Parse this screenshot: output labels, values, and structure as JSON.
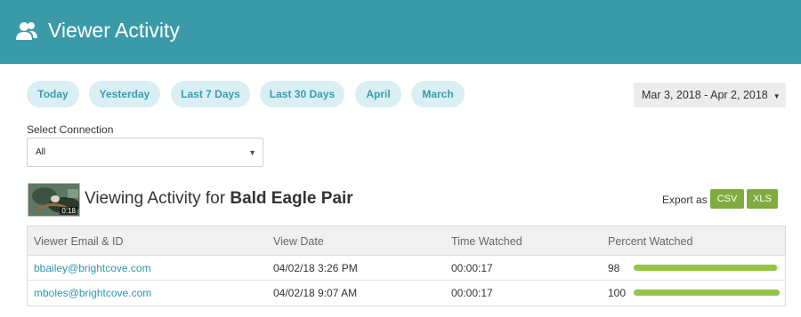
{
  "header": {
    "title": "Viewer Activity",
    "icon": "users-icon"
  },
  "filters": [
    {
      "label": "Today"
    },
    {
      "label": "Yesterday"
    },
    {
      "label": "Last 7 Days"
    },
    {
      "label": "Last 30 Days"
    },
    {
      "label": "April"
    },
    {
      "label": "March"
    }
  ],
  "date_range": {
    "value": "Mar 3, 2018 - Apr 2, 2018",
    "caret": "▼"
  },
  "connection": {
    "label": "Select Connection",
    "selected": "All"
  },
  "video": {
    "duration": "0:18",
    "title_prefix": "Viewing Activity for",
    "title": "Bald Eagle Pair"
  },
  "export": {
    "label": "Export as",
    "csv": "CSV",
    "xls": "XLS"
  },
  "table": {
    "headers": [
      "Viewer Email & ID",
      "View Date",
      "Time Watched",
      "Percent Watched"
    ],
    "rows": [
      {
        "email": "bbailey@brightcove.com",
        "date": "04/02/18 3:26 PM",
        "time": "00:00:17",
        "percent": "98",
        "fill": 0.98
      },
      {
        "email": "mboles@brightcove.com",
        "date": "04/02/18 9:07 AM",
        "time": "00:00:17",
        "percent": "100",
        "fill": 1.0
      }
    ]
  },
  "colors": {
    "header": "#3b9aa8",
    "pill_bg": "#d9eff4",
    "pill_text": "#3a9cb0",
    "export_button": "#7fac3d",
    "progress": "#96c343",
    "link": "#2a98b0"
  }
}
